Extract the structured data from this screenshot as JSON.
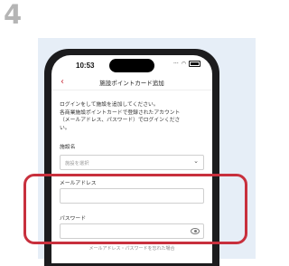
{
  "step_number": "4",
  "status_bar": {
    "time": "10:53",
    "icons": "···"
  },
  "nav": {
    "back_icon": "‹",
    "title": "施設ポイントカード追加"
  },
  "intro_lines": [
    "ログインをして施設を追加してください。",
    "各商業施設ポイントカードで登録されたアカウント",
    "（メールアドレス、パスワード）でログインくださ",
    "い。"
  ],
  "facility": {
    "label": "施設名",
    "placeholder": "施設を選択",
    "chevron_icon": "⌄"
  },
  "email": {
    "label": "メールアドレス",
    "value": ""
  },
  "password": {
    "label": "パスワード",
    "value": ""
  },
  "forgot_link": "メールアドレス・パスワードを忘れた場合",
  "colors": {
    "accent": "#c8303d",
    "background_panel": "#e6eef7",
    "phone_frame": "#1c1c1e"
  }
}
